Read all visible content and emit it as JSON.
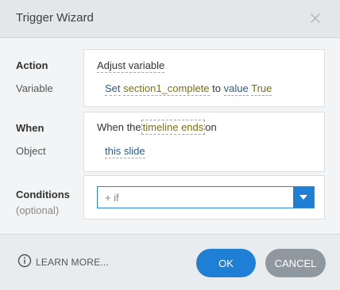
{
  "dialog": {
    "title": "Trigger Wizard"
  },
  "action": {
    "label": "Action",
    "value": "Adjust variable"
  },
  "variable": {
    "label": "Variable",
    "set_word": "Set",
    "name": "section1_complete",
    "to_word": "to",
    "operator": "value",
    "value": "True"
  },
  "when": {
    "label": "When",
    "prefix": "When the",
    "event": "timeline ends",
    "suffix": "on"
  },
  "object": {
    "label": "Object",
    "value": "this slide"
  },
  "conditions": {
    "label": "Conditions",
    "sublabel": "(optional)",
    "select_value": "+ if"
  },
  "footer": {
    "learn_more": "LEARN MORE...",
    "ok_label": "OK",
    "cancel_label": "CANCEL"
  },
  "colors": {
    "accent": "#1f7fd4",
    "cancel": "#8f989f",
    "token_olive": "#7a6f12",
    "token_blue": "#2a5d8a"
  }
}
